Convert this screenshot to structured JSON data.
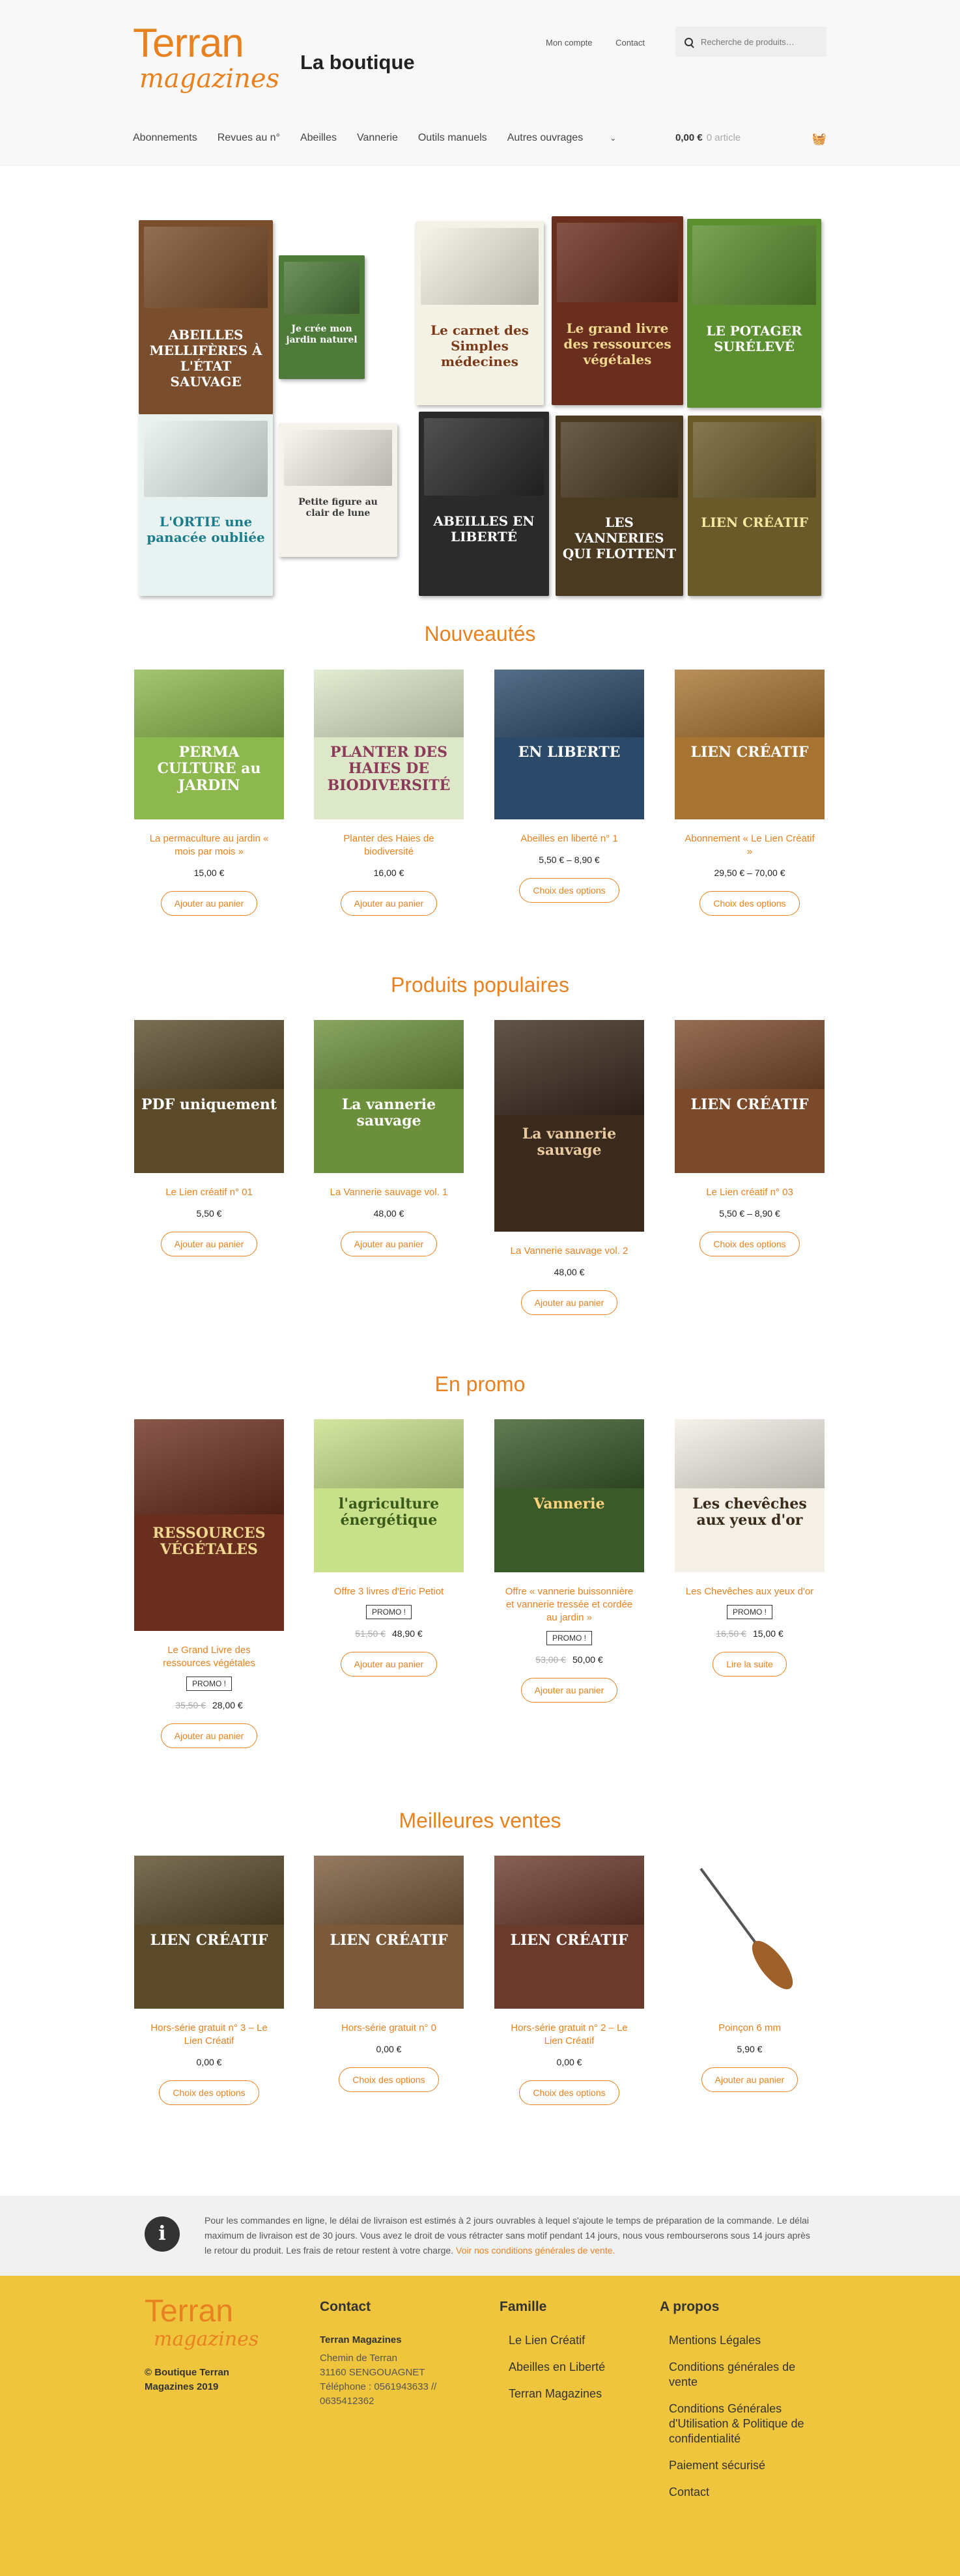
{
  "header": {
    "logo_text_1": "Terran",
    "logo_text_2": "magazines",
    "site_title": "La boutique",
    "top_links": [
      "Mon compte",
      "Contact"
    ],
    "search_placeholder": "Recherche de produits…",
    "nav": [
      "Abonnements",
      "Revues au n°",
      "Abeilles",
      "Vannerie",
      "Outils manuels",
      "Autres ouvrages"
    ],
    "cart_total": "0,00 €",
    "cart_items": "0 article"
  },
  "hero": {
    "covers": [
      {
        "t": "ABEILLES MELLIFÈRES À L'ÉTAT SAUVAGE",
        "bg": "#7a4e2c",
        "fg": "#fff"
      },
      {
        "t": "Je crée mon jardin naturel",
        "bg": "#4e7a3a",
        "fg": "#fff"
      },
      {
        "t": "Le carnet des Simples médecines",
        "bg": "#f4f2e4",
        "fg": "#7a3a1a"
      },
      {
        "t": "Le grand livre des ressources végétales",
        "bg": "#6a2e1e",
        "fg": "#f0d890"
      },
      {
        "t": "LE POTAGER SURÉLEVÉ",
        "bg": "#5c8f2f",
        "fg": "#fff"
      },
      {
        "t": "L'ORTIE une panacée oubliée",
        "bg": "#e8f2f0",
        "fg": "#1c7d8a"
      },
      {
        "t": "Petite figure au clair de lune",
        "bg": "#f4f2ea",
        "fg": "#3a3a3a"
      },
      {
        "t": "ABEILLES EN LIBERTÉ",
        "bg": "#2a2a2a",
        "fg": "#fff"
      },
      {
        "t": "LES VANNERIES QUI FLOTTENT",
        "bg": "#4a3a22",
        "fg": "#fff"
      },
      {
        "t": "LIEN CRÉATIF",
        "bg": "#6a5a2a",
        "fg": "#f6e7a0"
      }
    ]
  },
  "sections": [
    {
      "title": "Nouveautés",
      "products": [
        {
          "name": "La permaculture au jardin « mois par mois »",
          "old": "",
          "price": "15,00 €",
          "badge": "",
          "button": "Ajouter au panier",
          "cover": "PERMA CULTURE au JARDIN",
          "bg": "#8cb84e",
          "fg": "#fff"
        },
        {
          "name": "Planter des Haies de biodiversité",
          "old": "",
          "price": "16,00 €",
          "badge": "",
          "button": "Ajouter au panier",
          "cover": "PLANTER DES HAIES DE BIODIVERSITÉ",
          "bg": "#dce8c8",
          "fg": "#8b3a5a"
        },
        {
          "name": "Abeilles en liberté n° 1",
          "old": "",
          "price": "5,50 € – 8,90 €",
          "badge": "",
          "button": "Choix des options",
          "cover": "EN LIBERTE",
          "bg": "#2b4a6a",
          "fg": "#fff"
        },
        {
          "name": "Abonnement « Le Lien Créatif »",
          "old": "",
          "price": "29,50 € – 70,00 €",
          "badge": "",
          "button": "Choix des options",
          "cover": "LIEN CRÉATIF",
          "bg": "#a87432",
          "fg": "#fff"
        }
      ]
    },
    {
      "title": "Produits populaires",
      "products": [
        {
          "name": "Le Lien créatif n° 01",
          "old": "",
          "price": "5,50 €",
          "badge": "",
          "button": "Ajouter au panier",
          "cover": "PDF uniquement",
          "bg": "#5a4a2a",
          "fg": "#fff"
        },
        {
          "name": "La Vannerie sauvage vol. 1",
          "old": "",
          "price": "48,00 €",
          "badge": "",
          "button": "Ajouter au panier",
          "cover": "La vannerie sauvage",
          "bg": "#6b8f3a",
          "fg": "#fff"
        },
        {
          "name": "La Vannerie sauvage vol. 2",
          "old": "",
          "price": "48,00 €",
          "badge": "",
          "button": "Ajouter au panier",
          "cover": "La vannerie sauvage",
          "bg": "#3a2a1e",
          "fg": "#e9c9a0"
        },
        {
          "name": "Le Lien créatif n° 03",
          "old": "",
          "price": "5,50 € – 8,90 €",
          "badge": "",
          "button": "Choix des options",
          "cover": "LIEN CRÉATIF",
          "bg": "#7a4a2a",
          "fg": "#fff"
        }
      ]
    },
    {
      "title": "En promo",
      "products": [
        {
          "name": "Le Grand Livre des ressources végétales",
          "old": "35,50 €",
          "price": "28,00 €",
          "badge": "PROMO !",
          "button": "Ajouter au panier",
          "cover": "RESSOURCES VÉGÉTALES",
          "bg": "#6a2e1e",
          "fg": "#f0d890"
        },
        {
          "name": "Offre 3 livres d'Eric Petiot",
          "old": "51,50 €",
          "price": "48,90 €",
          "badge": "PROMO !",
          "button": "Ajouter au panier",
          "cover": "l'agriculture énergétique",
          "bg": "#c9e08a",
          "fg": "#3a5a1a"
        },
        {
          "name": "Offre « vannerie buissonnière et vannerie tressée et cordée au jardin »",
          "old": "53,00 €",
          "price": "50,00 €",
          "badge": "PROMO !",
          "button": "Ajouter au panier",
          "cover": "Vannerie",
          "bg": "#3a5a2a",
          "fg": "#ffd27a"
        },
        {
          "name": "Les Chevêches aux yeux d'or",
          "old": "16,50 €",
          "price": "15,00 €",
          "badge": "PROMO !",
          "button": "Lire la suite",
          "cover": "Les chevêches aux yeux d'or",
          "bg": "#f4f0e6",
          "fg": "#3a2a1a"
        }
      ]
    },
    {
      "title": "Meilleures ventes",
      "products": [
        {
          "name": "Hors-série gratuit n° 3 – Le Lien Créatif",
          "old": "",
          "price": "0,00 €",
          "badge": "",
          "button": "Choix des options",
          "cover": "LIEN CRÉATIF",
          "bg": "#5a4a2a",
          "fg": "#fff"
        },
        {
          "name": "Hors-série gratuit n° 0",
          "old": "",
          "price": "0,00 €",
          "badge": "",
          "button": "Choix des options",
          "cover": "LIEN CRÉATIF",
          "bg": "#7a5a3a",
          "fg": "#fff"
        },
        {
          "name": "Hors-série gratuit n° 2 – Le Lien Créatif",
          "old": "",
          "price": "0,00 €",
          "badge": "",
          "button": "Choix des options",
          "cover": "LIEN CRÉATIF",
          "bg": "#6a3a2a",
          "fg": "#fff"
        },
        {
          "name": "Poinçon 6 mm",
          "old": "",
          "price": "5,90 €",
          "badge": "",
          "button": "Ajouter au panier",
          "cover": "",
          "bg": "#ffffff",
          "fg": "#000"
        }
      ]
    }
  ],
  "notice": {
    "text": "Pour les commandes en ligne, le délai de livraison est estimés à 2 jours ouvrables à lequel s'ajoute le temps de préparation de la commande. Le délai maximum de livraison est de 30 jours. Vous avez le droit de vous rétracter sans motif pendant 14 jours, nous vous rembourserons sous 14 jours après le retour du produit. Les frais de retour restent à votre charge.",
    "link": "Voir nos conditions générales de vente."
  },
  "footer": {
    "logo_text_1": "Terran",
    "logo_text_2": "magazines",
    "copyright": "© Boutique Terran Magazines 2019",
    "contact_title": "Contact",
    "contact_lines": [
      "Terran Magazines",
      "Chemin de Terran",
      "31160 SENGOUAGNET",
      "Téléphone : 0561943633 // 0635412362"
    ],
    "famille_title": "Famille",
    "famille_links": [
      "Le Lien Créatif",
      "Abeilles en Liberté",
      "Terran Magazines"
    ],
    "apropos_title": "A propos",
    "apropos_links": [
      "Mentions Légales",
      "Conditions générales de vente",
      "Conditions Générales d'Utilisation & Politique de confidentialité",
      "Paiement sécurisé",
      "Contact"
    ]
  }
}
